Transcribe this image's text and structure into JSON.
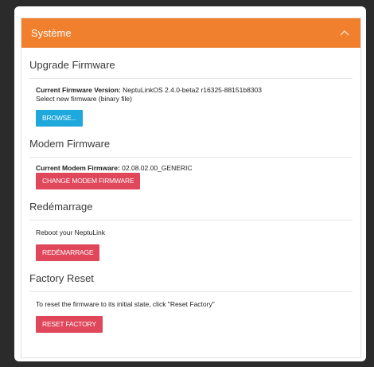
{
  "panel": {
    "title": "Système"
  },
  "upgrade": {
    "title": "Upgrade Firmware",
    "version_label": "Current Firmware Version:",
    "version_value": "NeptuLinkOS 2.4.0-beta2 r16325-88151b8303",
    "hint": "Select new firmware (binary file)",
    "browse_label": "BROWSE..."
  },
  "modem": {
    "title": "Modem Firmware",
    "version_label": "Current Modem Firmware:",
    "version_value": "02.08.02.00_GENERIC",
    "button_label": "CHANGE MODEM FIRMWARE"
  },
  "reboot": {
    "title": "Redémarrage",
    "text": "Reboot your NeptuLink",
    "button_label": "REDÉMARRAGE"
  },
  "factory": {
    "title": "Factory Reset",
    "text": "To reset the firmware to its initial state, click \"Reset Factory\"",
    "button_label": "RESET FACTORY"
  },
  "colors": {
    "header": "#f07f2e",
    "primary": "#1fa8dc",
    "danger": "#e0475a"
  },
  "icons": {
    "collapse": "chevron-up-icon"
  }
}
